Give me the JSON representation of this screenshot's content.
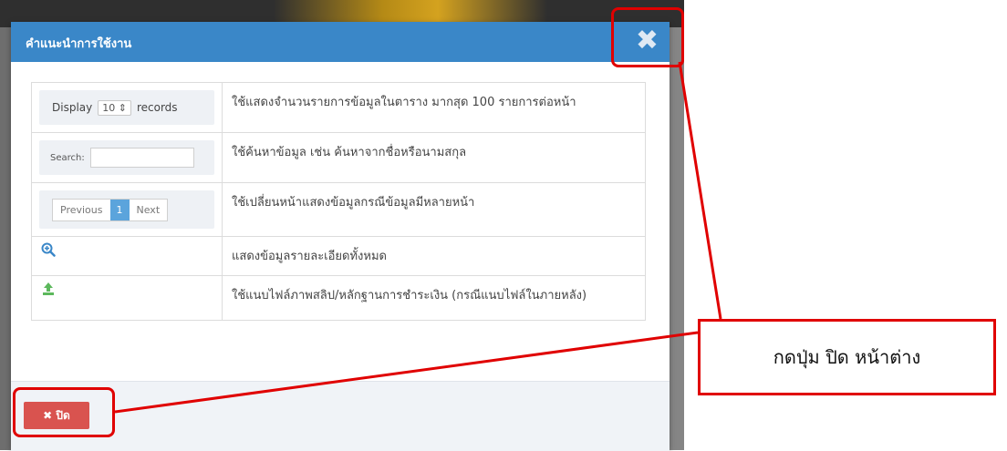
{
  "modal": {
    "title": "คำแนะนำการใช้งาน",
    "close_symbol": "✖"
  },
  "guide": {
    "display": {
      "label_before": "Display",
      "select_value": "10 ⇕",
      "label_after": "records",
      "description": "ใช้แสดงจำนวนรายการข้อมูลในตาราง มากสุด 100 รายการต่อหน้า"
    },
    "search": {
      "label": "Search:",
      "description": "ใช้ค้นหาข้อมูล เช่น ค้นหาจากชื่อหรือนามสกุล"
    },
    "pager": {
      "prev": "Previous",
      "page": "1",
      "next": "Next",
      "description": "ใช้เปลี่ยนหน้าแสดงข้อมูลกรณีข้อมูลมีหลายหน้า"
    },
    "zoom": {
      "description": "แสดงข้อมูลรายละเอียดทั้งหมด"
    },
    "upload": {
      "description": "ใช้แนบไฟล์ภาพสลิป/หลักฐานการชำระเงิน (กรณีแนบไฟล์ในภายหลัง)"
    }
  },
  "footer": {
    "close_label": "✖ ปิด"
  },
  "annotation": {
    "callout_text": "กดปุ่ม ปิด หน้าต่าง"
  },
  "colors": {
    "header": "#3a87c8",
    "button": "#d9534f",
    "annotation": "#e00000"
  }
}
